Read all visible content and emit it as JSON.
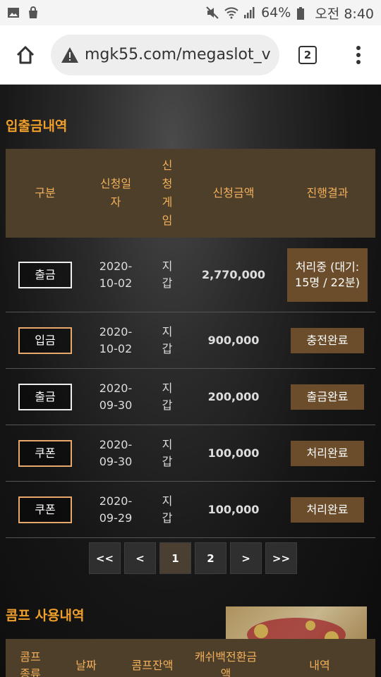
{
  "status": {
    "battery": "64%",
    "time": "오전 8:40"
  },
  "browser": {
    "url": "mgk55.com/megaslot_v",
    "tab_count": "2"
  },
  "deposit_section": {
    "title": "입출금내역",
    "headers": [
      "구분",
      "신청일자",
      "신청게임",
      "신청금액",
      "진행결과"
    ],
    "rows": [
      {
        "type": "출금",
        "date": "2020-10-02",
        "game": "지갑",
        "amount": "2,770,000",
        "result": "처리중 (대기: 15명 / 22분)"
      },
      {
        "type": "입금",
        "date": "2020-10-02",
        "game": "지갑",
        "amount": "900,000",
        "result": "충전완료"
      },
      {
        "type": "출금",
        "date": "2020-09-30",
        "game": "지갑",
        "amount": "200,000",
        "result": "출금완료"
      },
      {
        "type": "쿠폰",
        "date": "2020-09-30",
        "game": "지갑",
        "amount": "100,000",
        "result": "처리완료"
      },
      {
        "type": "쿠폰",
        "date": "2020-09-29",
        "game": "지갑",
        "amount": "100,000",
        "result": "처리완료"
      }
    ]
  },
  "pagination": {
    "first": "<<",
    "prev": "<",
    "pages": [
      "1",
      "2"
    ],
    "next": ">",
    "last": ">>",
    "current": "1"
  },
  "comp_section": {
    "title": "콤프 사용내역",
    "headers": [
      "콤프종류",
      "날짜",
      "콤프잔액",
      "캐쉬백전환금액",
      "내역"
    ]
  }
}
